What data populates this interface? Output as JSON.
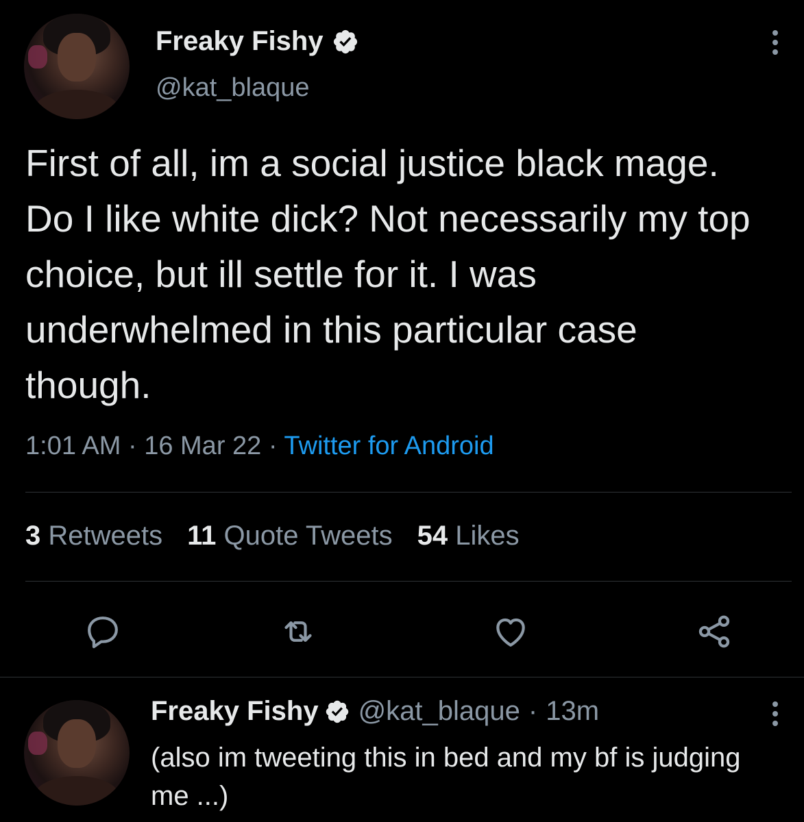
{
  "tweet": {
    "author_name": "Freaky Fishy",
    "author_handle": "@kat_blaque",
    "text": "First of all, im a social justice black mage. Do I like white dick? Not necessarily my top choice, but ill settle for it. I was underwhelmed in this particular case though.",
    "time": "1:01 AM",
    "date": "16 Mar 22",
    "separator": "·",
    "source": "Twitter for Android",
    "stats": {
      "retweets_count": "3",
      "retweets_label": "Retweets",
      "quotes_count": "11",
      "quotes_label": "Quote Tweets",
      "likes_count": "54",
      "likes_label": "Likes"
    },
    "actions": [
      "reply-icon",
      "retweet-icon",
      "like-icon",
      "share-icon"
    ]
  },
  "reply": {
    "author_name": "Freaky Fishy",
    "author_handle": "@kat_blaque",
    "separator": "·",
    "time": "13m",
    "text": "(also im tweeting this in bed and my bf is judging me ...)"
  },
  "colors": {
    "background": "#000000",
    "text_primary": "#e7e9ea",
    "text_secondary": "#8b98a5",
    "accent": "#1d9bf0",
    "divider": "#2f3336"
  }
}
